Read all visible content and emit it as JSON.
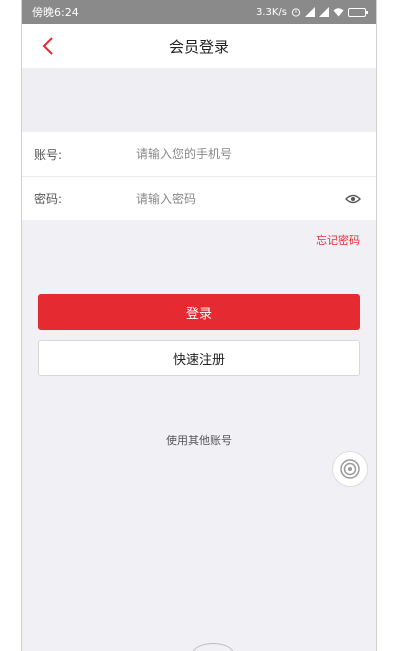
{
  "status_bar": {
    "time": "傍晚6:24",
    "speed": "3.3K/s"
  },
  "header": {
    "title": "会员登录"
  },
  "form": {
    "account_label": "账号:",
    "account_placeholder": "请输入您的手机号",
    "password_label": "密码:",
    "password_placeholder": "请输入密码"
  },
  "links": {
    "forgot_password": "忘记密码"
  },
  "buttons": {
    "login": "登录",
    "register": "快速注册"
  },
  "other_accounts": "使用其他账号",
  "colors": {
    "accent": "#e62a32",
    "background": "#f1f0f5"
  }
}
